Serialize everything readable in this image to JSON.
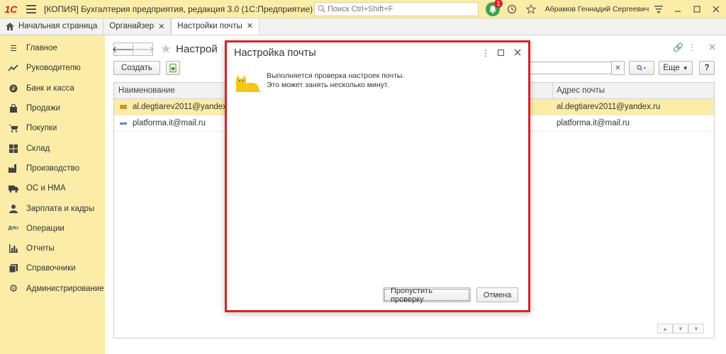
{
  "titlebar": {
    "logo": "1С",
    "title": "[КОПИЯ] Бухгалтерия предприятия, редакция 3.0  (1С:Предприятие)",
    "search_placeholder": "Поиск Ctrl+Shift+F",
    "notification_count": "1",
    "user": "Абрамов Геннадий Сергеевич"
  },
  "tabs": [
    {
      "label": "Начальная страница"
    },
    {
      "label": "Органайзер"
    },
    {
      "label": "Настройки почты"
    }
  ],
  "sidebar": {
    "items": [
      {
        "label": "Главное",
        "icon": "menu-icon"
      },
      {
        "label": "Руководителю",
        "icon": "trend-icon"
      },
      {
        "label": "Банк и касса",
        "icon": "coin-icon"
      },
      {
        "label": "Продажи",
        "icon": "bag-icon"
      },
      {
        "label": "Покупки",
        "icon": "cart-icon"
      },
      {
        "label": "Склад",
        "icon": "warehouse-icon"
      },
      {
        "label": "Производство",
        "icon": "factory-icon"
      },
      {
        "label": "ОС и НМА",
        "icon": "truck-icon"
      },
      {
        "label": "Зарплата и кадры",
        "icon": "person-icon"
      },
      {
        "label": "Операции",
        "icon": "dt-kt-icon"
      },
      {
        "label": "Отчеты",
        "icon": "bar-chart-icon"
      },
      {
        "label": "Справочники",
        "icon": "book-icon"
      },
      {
        "label": "Администрирование",
        "icon": "gear-icon"
      }
    ]
  },
  "main": {
    "title": "Настрой",
    "create_label": "Создать",
    "more_label": "Еще",
    "help_label": "?",
    "columns": {
      "name": "Наименование",
      "address": "Адрес почты"
    },
    "rows": [
      {
        "name": "al.degtiarev2011@yandex.ru",
        "address": "al.degtiarev2011@yandex.ru"
      },
      {
        "name": "platforma.it@mail.ru",
        "address": "platforma.it@mail.ru"
      }
    ]
  },
  "dialog": {
    "title": "Настройка почты",
    "message_line1": "Выполняется проверка настроек почты.",
    "message_line2": "Это может занять несколько минут.",
    "skip_label": "Пропустить проверку",
    "cancel_label": "Отмена"
  },
  "colors": {
    "accent_yellow": "#fbeda8",
    "highlight_red": "#d8232a",
    "logo_red": "#d4201c"
  }
}
